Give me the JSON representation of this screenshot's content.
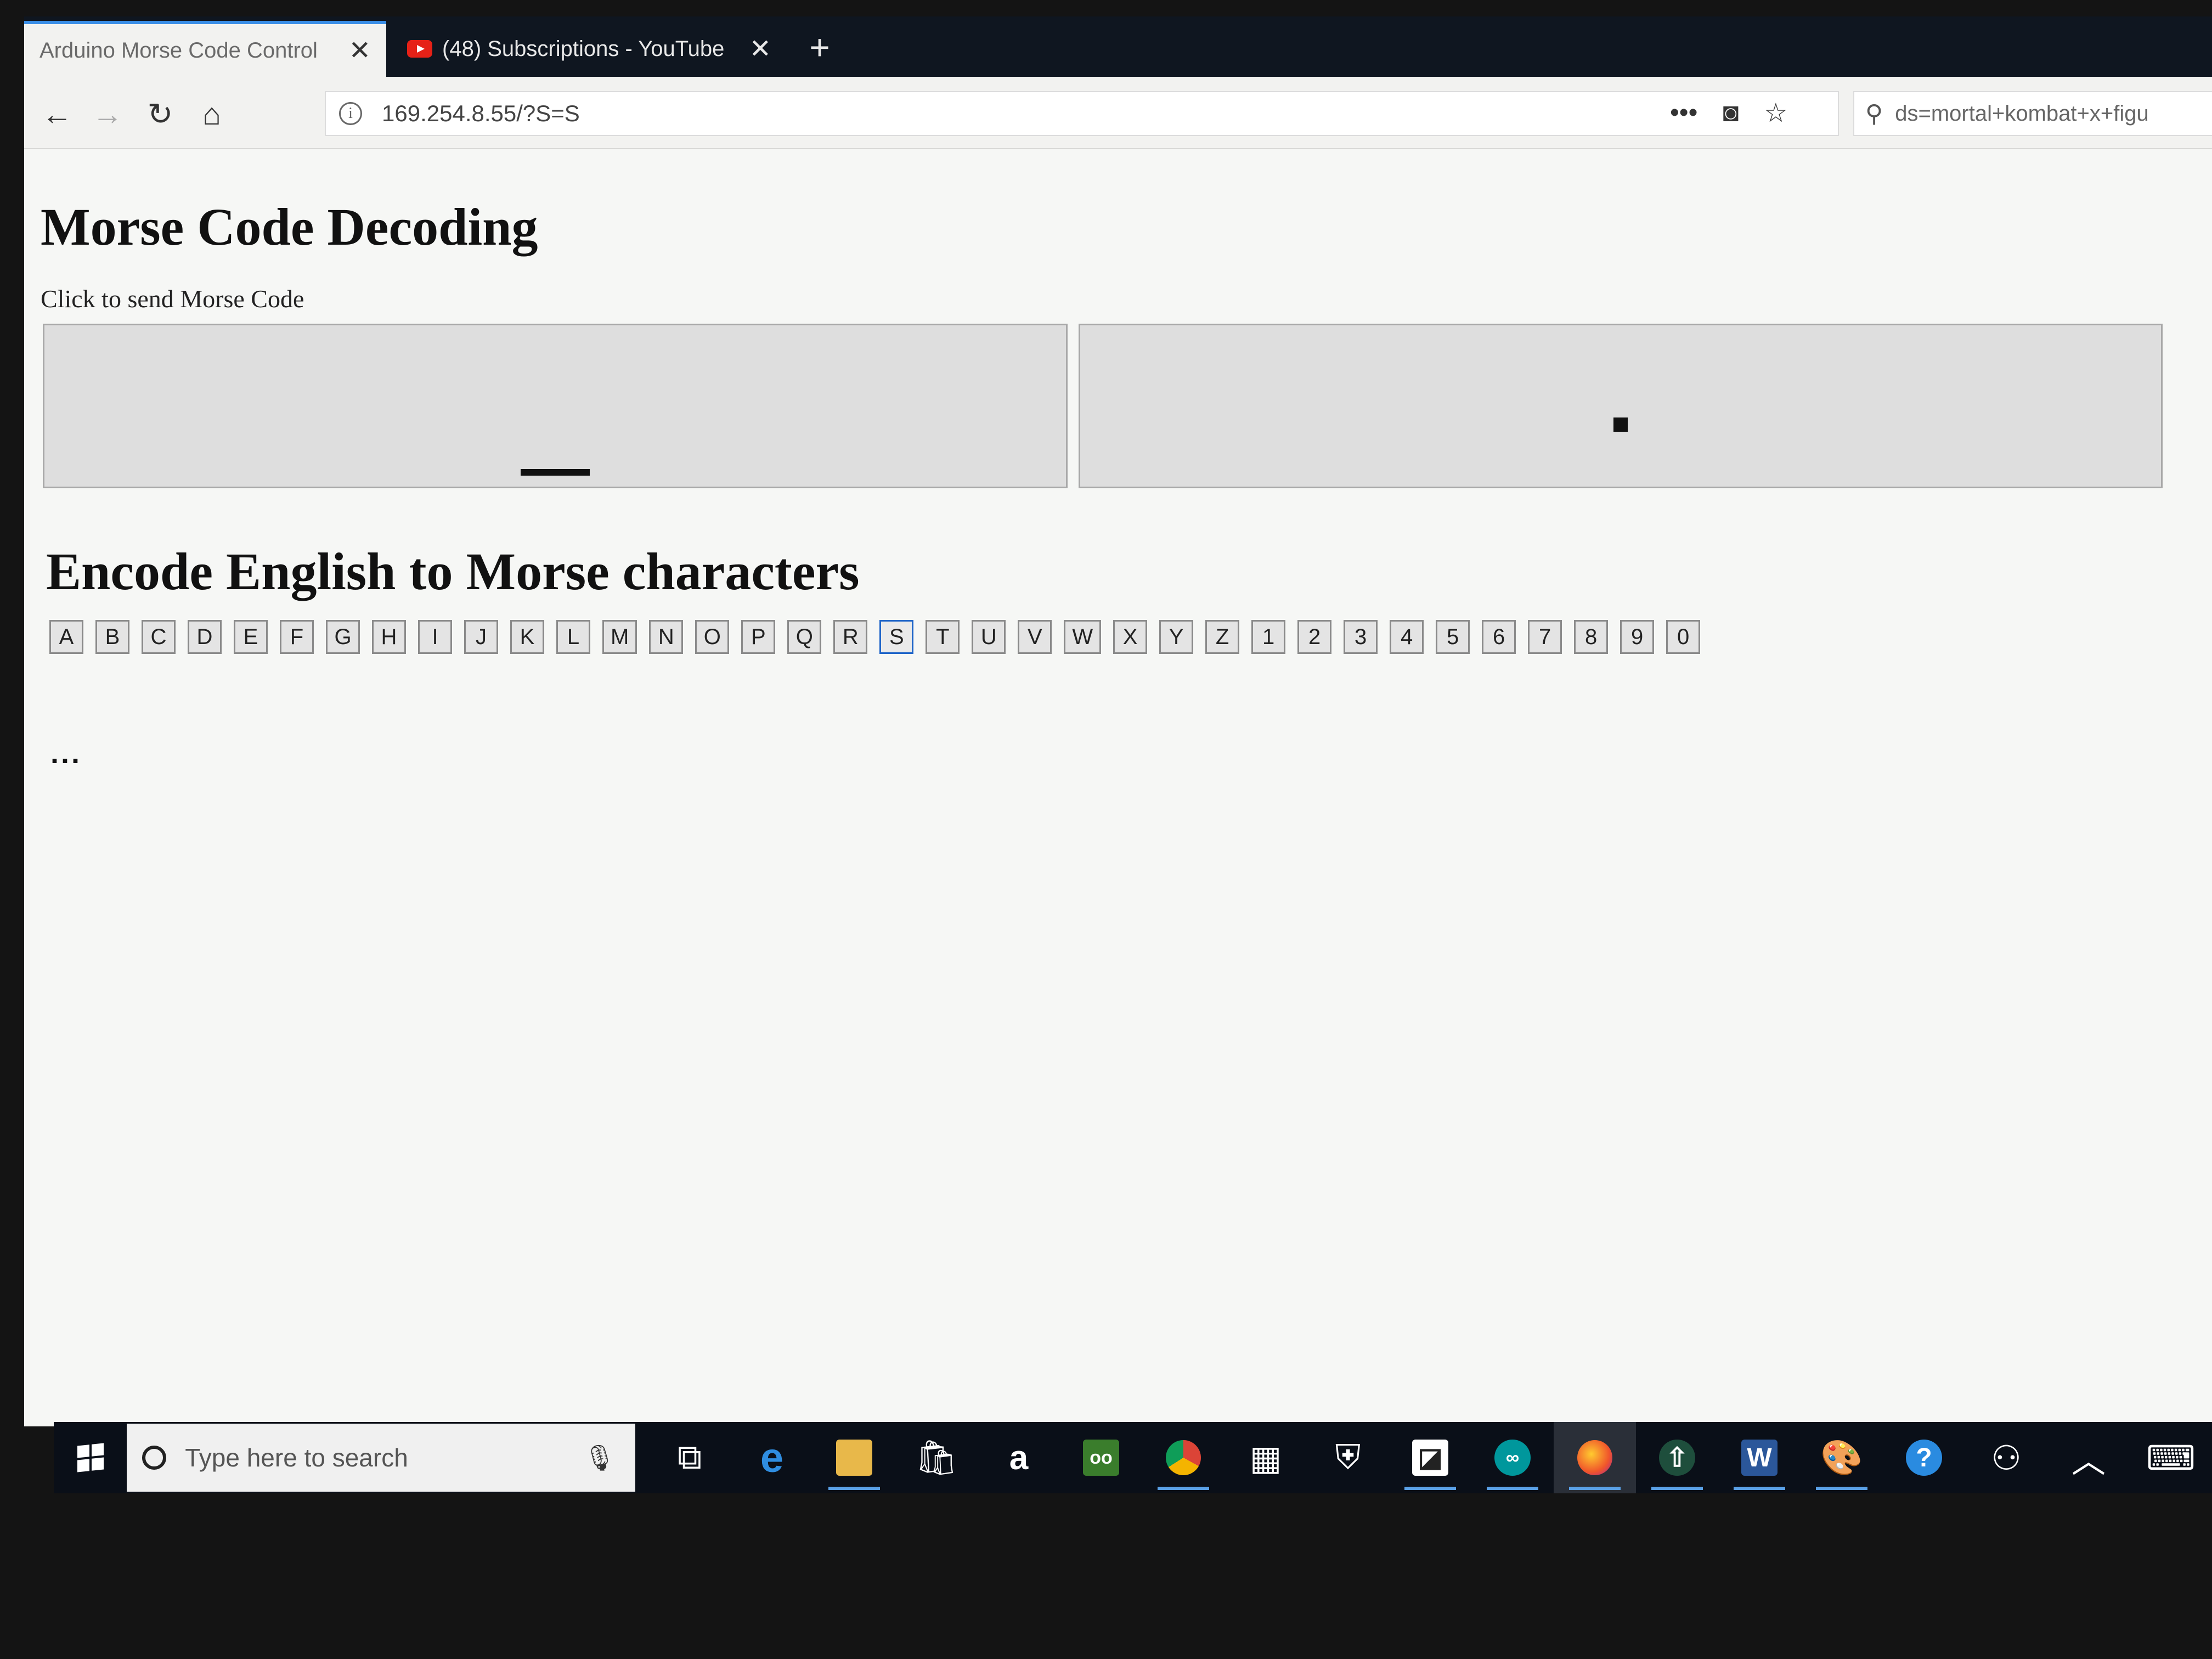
{
  "browser": {
    "tabs": [
      {
        "title": "Arduino Morse Code Control",
        "active": true
      },
      {
        "title": "(48) Subscriptions - YouTube",
        "active": false
      }
    ],
    "new_tab_label": "+",
    "tab_close_label": "✕",
    "url": "169.254.8.55/?S=S",
    "search_text": "ds=mortal+kombat+x+figu",
    "icons": {
      "back": "back-arrow-icon",
      "forward": "forward-arrow-icon",
      "reload": "reload-icon",
      "home": "home-icon",
      "info": "info-icon",
      "menu": "more-actions-icon",
      "pocket": "pocket-icon",
      "bookmark": "star-icon",
      "search": "search-icon"
    }
  },
  "page": {
    "title": "Morse Code Decoding",
    "click_label": "Click to send Morse Code",
    "encode_title": "Encode English to Morse characters",
    "keys": [
      "A",
      "B",
      "C",
      "D",
      "E",
      "F",
      "G",
      "H",
      "I",
      "J",
      "K",
      "L",
      "M",
      "N",
      "O",
      "P",
      "Q",
      "R",
      "S",
      "T",
      "U",
      "V",
      "W",
      "X",
      "Y",
      "Z",
      "1",
      "2",
      "3",
      "4",
      "5",
      "6",
      "7",
      "8",
      "9",
      "0"
    ],
    "active_key": "S",
    "output": "..."
  },
  "taskbar": {
    "search_placeholder": "Type here to search",
    "apps": [
      "task-view",
      "edge",
      "file-explorer",
      "store",
      "amazon",
      "tripadvisor",
      "chrome",
      "photos",
      "defender",
      "sticky-notes",
      "arduino",
      "firefox",
      "sync-app",
      "word",
      "paint-3d",
      "help",
      "people",
      "tray-chevron",
      "keyboard"
    ]
  }
}
